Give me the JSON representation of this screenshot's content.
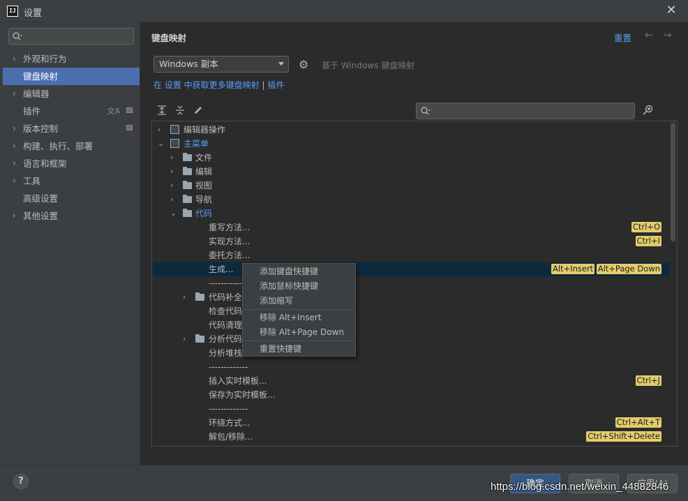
{
  "window": {
    "logo_text": "IJ",
    "title": "设置",
    "close_glyph": "✕"
  },
  "sidebar": {
    "search_placeholder": "",
    "items": [
      {
        "label": "外观和行为",
        "chevron": "›",
        "selected": false
      },
      {
        "label": "键盘映射",
        "chevron": "",
        "selected": true
      },
      {
        "label": "编辑器",
        "chevron": "›",
        "selected": false
      },
      {
        "label": "插件",
        "chevron": "",
        "selected": false
      },
      {
        "label": "版本控制",
        "chevron": "›",
        "selected": false
      },
      {
        "label": "构建、执行、部署",
        "chevron": "›",
        "selected": false
      },
      {
        "label": "语言和框架",
        "chevron": "›",
        "selected": false
      },
      {
        "label": "工具",
        "chevron": "›",
        "selected": false
      },
      {
        "label": "高级设置",
        "chevron": "",
        "selected": false
      },
      {
        "label": "其他设置",
        "chevron": "›",
        "selected": false
      }
    ]
  },
  "header": {
    "breadcrumb": "键盘映射",
    "reset": "重置",
    "back_glyph": "←",
    "forward_glyph": "→"
  },
  "keymap": {
    "scheme": "Windows 副本",
    "based_on": "基于 Windows 键盘映射",
    "plugins_prefix": "在 设置 中获取更多键盘映射",
    "plugins_sep": "|",
    "plugins_link": "插件"
  },
  "tree": {
    "search_placeholder": "",
    "rows": [
      {
        "label": "编辑器操作",
        "chevron": "›",
        "icon": "keymap",
        "blue": false
      },
      {
        "label": "主菜单",
        "chevron": "⌄",
        "icon": "keymap",
        "blue": true
      },
      {
        "label": "文件",
        "chevron": "›",
        "icon": "folder",
        "blue": false
      },
      {
        "label": "编辑",
        "chevron": "›",
        "icon": "folder",
        "blue": false
      },
      {
        "label": "视图",
        "chevron": "›",
        "icon": "folder",
        "blue": false
      },
      {
        "label": "导航",
        "chevron": "›",
        "icon": "folder",
        "blue": false
      },
      {
        "label": "代码",
        "chevron": "⌄",
        "icon": "folder",
        "blue": true
      },
      {
        "label": "重写方法...",
        "shortcuts": [
          "Ctrl+O"
        ]
      },
      {
        "label": "实现方法...",
        "shortcuts": [
          "Ctrl+I"
        ]
      },
      {
        "label": "委托方法..."
      },
      {
        "label": "生成...",
        "shortcuts": [
          "Alt+Insert",
          "Alt+Page Down"
        ],
        "selected": true
      },
      {
        "label": "-------------"
      },
      {
        "label": "代码补全",
        "chevron": "›",
        "icon": "folder"
      },
      {
        "label": "检查代码"
      },
      {
        "label": "代码清理"
      },
      {
        "label": "分析代码",
        "chevron": "›",
        "icon": "folder"
      },
      {
        "label": "分析堆栈"
      },
      {
        "label": "-------------"
      },
      {
        "label": "插入实时模板...",
        "shortcuts": [
          "Ctrl+J"
        ]
      },
      {
        "label": "保存为实时模板..."
      },
      {
        "label": "-------------"
      },
      {
        "label": "环绕方式...",
        "shortcuts": [
          "Ctrl+Alt+T"
        ]
      },
      {
        "label": "解包/移除...",
        "shortcuts": [
          "Ctrl+Shift+Delete"
        ]
      }
    ]
  },
  "context_menu": {
    "items": [
      "添加键盘快捷键",
      "添加鼠标快捷键",
      "添加缩写",
      "移除 Alt+Insert",
      "移除 Alt+Page Down",
      "重置快捷键"
    ]
  },
  "footer": {
    "help": "?",
    "ok": "确定",
    "cancel": "取消",
    "apply": "应用(A)",
    "watermark": "https://blog.csdn.net/weixin_44882846"
  },
  "colors": {
    "accent": "#4b6eaf",
    "link": "#589df6",
    "shortcut_bg": "#e3cc6b",
    "annotation_red": "#e01010",
    "annotation_blue": "#1b1bd8"
  }
}
